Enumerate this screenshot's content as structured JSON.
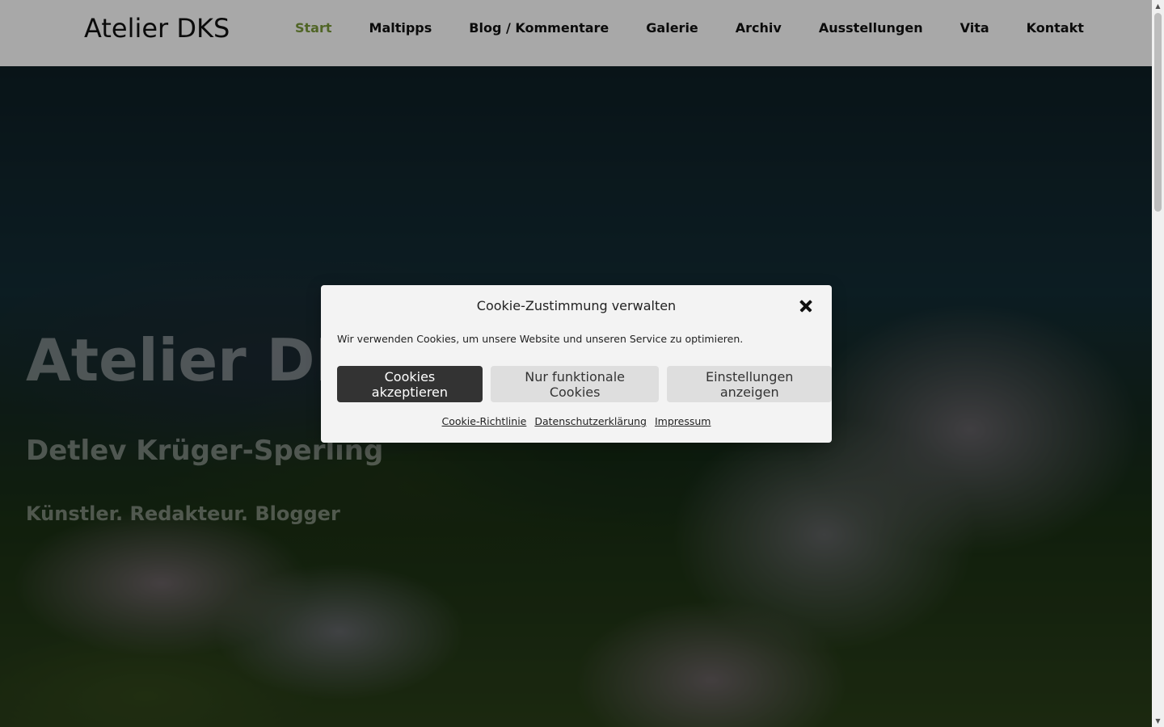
{
  "site": {
    "brand": "Atelier DKS",
    "nav": [
      {
        "label": "Start",
        "active": true
      },
      {
        "label": "Maltipps"
      },
      {
        "label": "Blog / Kommentare"
      },
      {
        "label": "Galerie"
      },
      {
        "label": "Archiv"
      },
      {
        "label": "Ausstellungen"
      },
      {
        "label": "Vita"
      },
      {
        "label": "Kontakt"
      }
    ],
    "nav_active_color": "#7a9a3a"
  },
  "hero": {
    "title": "Atelier DKS",
    "subtitle": "Detlev Krüger-Sperling",
    "tagline": "Künstler. Redakteur. Blogger"
  },
  "cookie": {
    "title": "Cookie-Zustimmung verwalten",
    "text": "Wir verwenden Cookies, um unsere Website und unseren Service zu optimieren.",
    "buttons": {
      "accept": "Cookies akzeptieren",
      "functional": "Nur funktionale Cookies",
      "settings": "Einstellungen anzeigen"
    },
    "links": {
      "policy": "Cookie-Richtlinie",
      "privacy": "Datenschutzerklärung",
      "imprint": "Impressum"
    },
    "close_icon": "close-icon"
  }
}
